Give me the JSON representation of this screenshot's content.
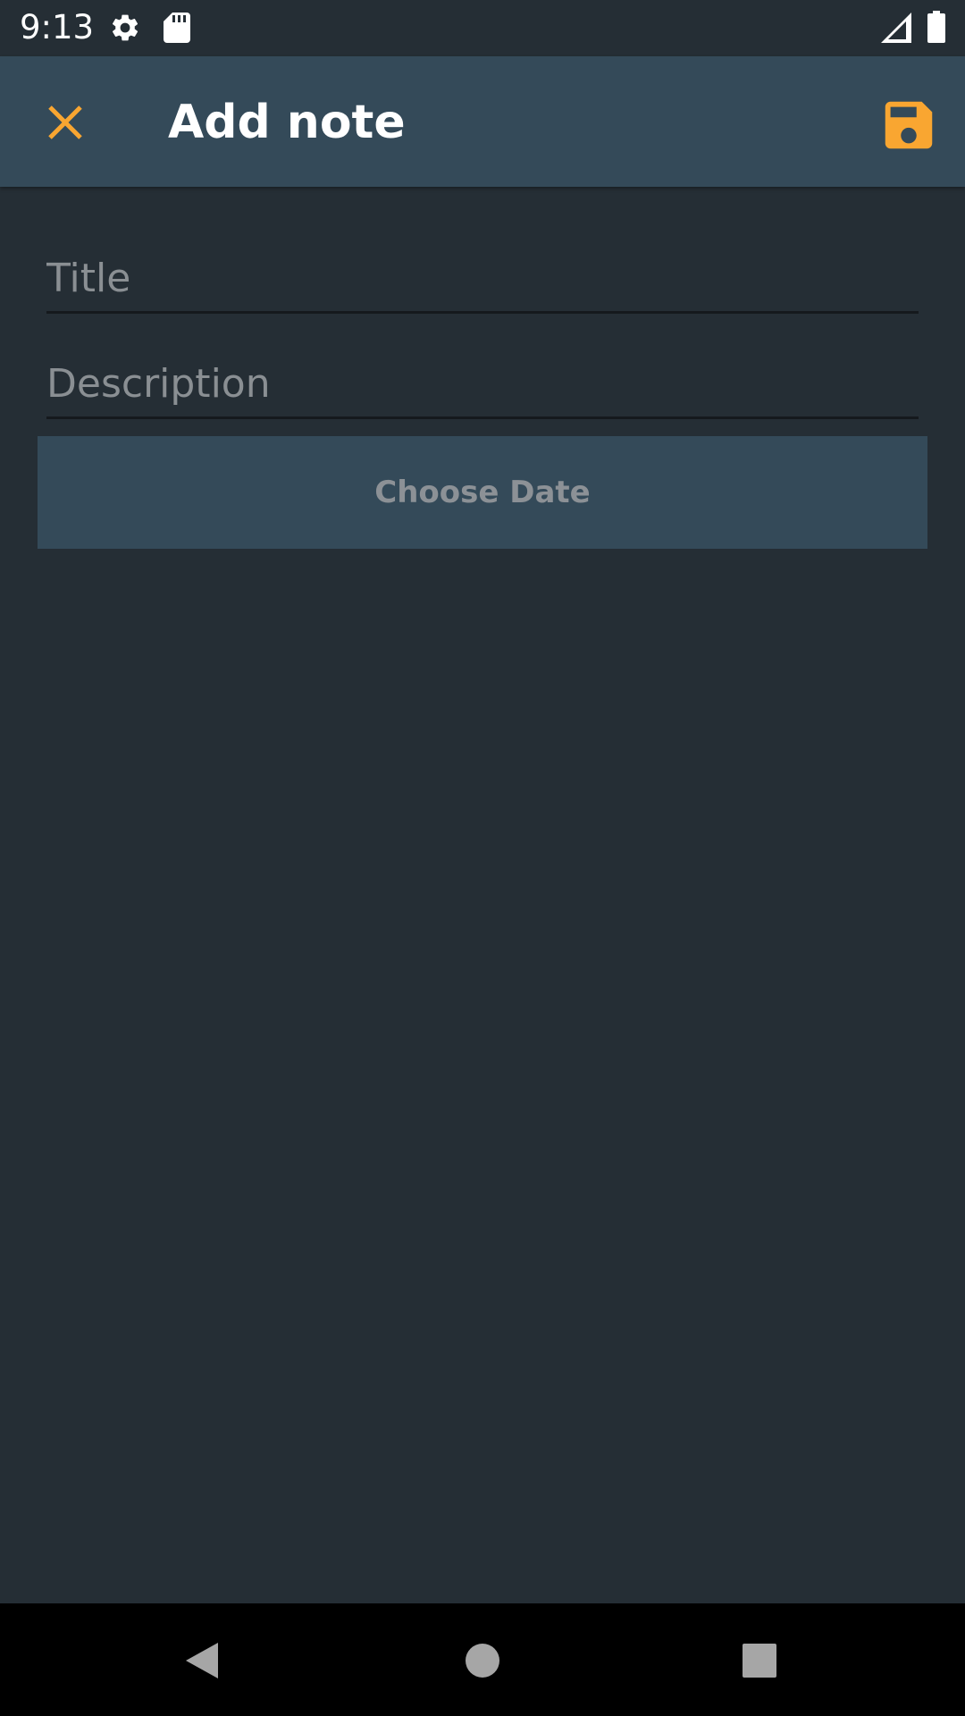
{
  "status_bar": {
    "time": "9:13",
    "icons": [
      "gear-icon",
      "sd-card-icon",
      "signal-icon",
      "battery-icon"
    ]
  },
  "app_bar": {
    "title": "Add note",
    "close_icon": "close-icon",
    "save_icon": "save-icon",
    "accent_color": "#F9A631",
    "background_color": "#344A59"
  },
  "form": {
    "title_placeholder": "Title",
    "title_value": "",
    "description_placeholder": "Description",
    "description_value": "",
    "choose_date_label": "Choose Date"
  },
  "nav_bar": {
    "icons": [
      "back-triangle-icon",
      "home-circle-icon",
      "recents-square-icon"
    ]
  },
  "colors": {
    "background": "#252E35",
    "surface": "#344A59",
    "accent": "#F9A631"
  }
}
